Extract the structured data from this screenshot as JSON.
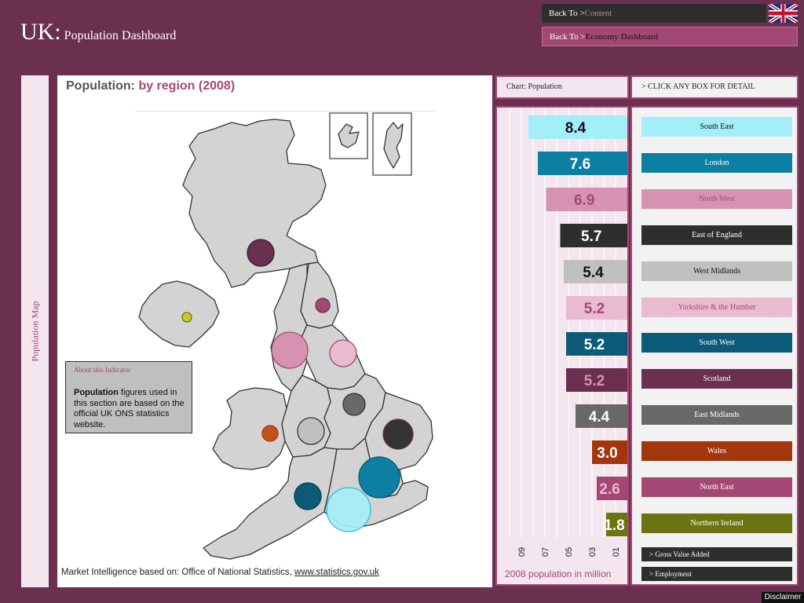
{
  "header": {
    "brand_big": "UK:",
    "brand_small": "Population Dashboard",
    "back_prefix": "Back  To  >",
    "back_content": "Content",
    "back_economy": "Economy Dashboard"
  },
  "side_label": "Population Map",
  "main": {
    "title_plain": "Population:",
    "title_accent": "by region (2008)",
    "footer_text": "Market Intelligence based on: Office of National Statistics, ",
    "footer_link": "www.statistics.gov.uk",
    "info": {
      "title": "About this Indicator",
      "body_bold": "Population",
      "body_rest": " figures used in this section are based on the official UK ONS statistics website."
    }
  },
  "chart_header": "Chart: Population",
  "click_header": "> CLICK ANY BOX FOR DETAIL",
  "chart_caption": "2008 population in million",
  "colors": {
    "south_east": "#a3eef9",
    "london": "#0c7fa3",
    "north_west": "#d693b1",
    "east_england": "#2e2e2e",
    "west_midlands": "#c0c0c0",
    "yorkshire": "#e9bbd0",
    "south_west": "#0b5a78",
    "scotland": "#6b3050",
    "east_midlands": "#686868",
    "wales": "#a3360d",
    "north_east": "#a34874",
    "northern_ireland": "#6b7410"
  },
  "chart_data": {
    "type": "bar",
    "orientation": "horizontal",
    "categories": [
      "South East",
      "London",
      "North West",
      "East of England",
      "West Midlands",
      "Yorkshire & the Humber",
      "South West",
      "Scotland",
      "East Midlands",
      "Wales",
      "North East",
      "Northern Ireland"
    ],
    "values": [
      8.4,
      7.6,
      6.9,
      5.7,
      5.4,
      5.2,
      5.2,
      5.2,
      4.4,
      3.0,
      2.6,
      1.8
    ],
    "value_labels": [
      "8.4",
      "7.6",
      "6.9",
      "5.7",
      "5.4",
      "5.2",
      "5.2",
      "5.2",
      "4.4",
      "3.0",
      "2.6",
      "1.8"
    ],
    "colors": [
      "#a3eef9",
      "#0c7fa3",
      "#d693b1",
      "#2e2e2e",
      "#c0c0c0",
      "#e9bbd0",
      "#0b5a78",
      "#6b3050",
      "#686868",
      "#a3360d",
      "#a34874",
      "#6b7410"
    ],
    "label_colors": [
      "#111111",
      "#ffffff",
      "#a34874",
      "#ffffff",
      "#111111",
      "#a34874",
      "#ffffff",
      "#d693b1",
      "#ffffff",
      "#ffffff",
      "#e9bbd0",
      "#ffffff"
    ],
    "ticks": [
      "09",
      "07",
      "05",
      "03",
      "01"
    ],
    "tick_values": [
      9,
      7,
      5,
      3,
      1
    ],
    "xlim": [
      0,
      10
    ],
    "xlabel": "2008 population in million",
    "grid": true
  },
  "regions": [
    {
      "label": "South East",
      "bg": "#a3eef9",
      "fg": "#111111"
    },
    {
      "label": "London",
      "bg": "#0c7fa3",
      "fg": "#ffffff"
    },
    {
      "label": "North West",
      "bg": "#d693b1",
      "fg": "#a34874"
    },
    {
      "label": "East of England",
      "bg": "#2e2e2e",
      "fg": "#ffffff"
    },
    {
      "label": "West Midlands",
      "bg": "#c0c0c0",
      "fg": "#111111"
    },
    {
      "label": "Yorkshire & the Humber",
      "bg": "#e9bbd0",
      "fg": "#a34874"
    },
    {
      "label": "South West",
      "bg": "#0b5a78",
      "fg": "#ffffff"
    },
    {
      "label": "Scotland",
      "bg": "#6b3050",
      "fg": "#ffffff"
    },
    {
      "label": "East Midlands",
      "bg": "#686868",
      "fg": "#ffffff"
    },
    {
      "label": "Wales",
      "bg": "#a3360d",
      "fg": "#ffffff"
    },
    {
      "label": "North East",
      "bg": "#a34874",
      "fg": "#ffffff"
    },
    {
      "label": "Northern Ireland",
      "bg": "#6b7410",
      "fg": "#ffffff"
    }
  ],
  "nav_links": [
    "> Gross Value Added",
    "> Employment"
  ],
  "disclaimer": "Disclaimer"
}
